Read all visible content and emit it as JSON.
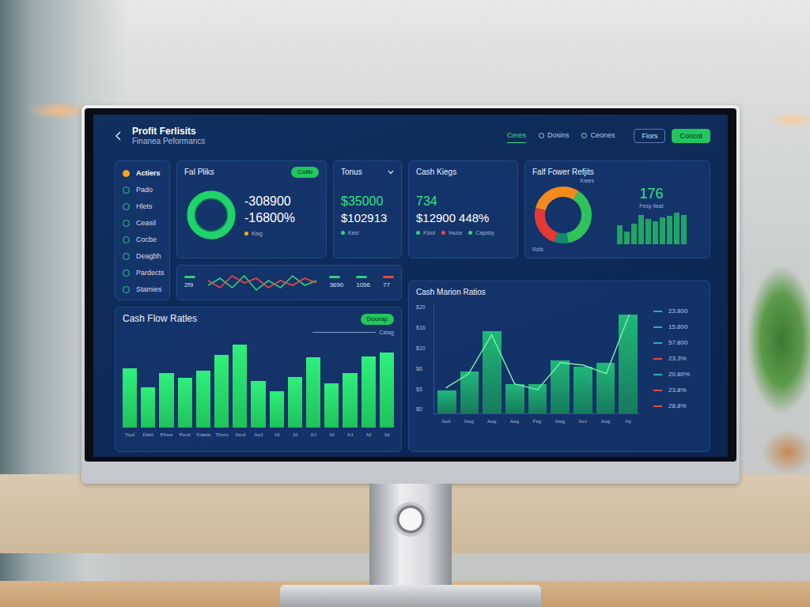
{
  "header": {
    "title": "Profit Ferlisits",
    "subtitle": "Finanea Peformancs",
    "nav": [
      {
        "label": "Ceres",
        "selected": true
      },
      {
        "label": "Dosins",
        "selected": false
      },
      {
        "label": "Ceones",
        "selected": false
      }
    ],
    "buttons": [
      {
        "label": "Fiors",
        "kind": "outline"
      },
      {
        "label": "Concot",
        "kind": "filled"
      }
    ]
  },
  "sidebar": {
    "items": [
      {
        "label": "Actiers",
        "color": "#f5a623",
        "selected": true
      },
      {
        "label": "Pado",
        "color": "#2fd27a",
        "selected": false
      },
      {
        "label": "Hlets",
        "color": "#2fd27a",
        "selected": false
      },
      {
        "label": "Ceasil",
        "color": "#2fd27a",
        "selected": false
      },
      {
        "label": "Cocbe",
        "color": "#2fd27a",
        "selected": false
      },
      {
        "label": "Deagbh",
        "color": "#2fd27a",
        "selected": false
      },
      {
        "label": "Pardects",
        "color": "#2fd27a",
        "selected": false
      },
      {
        "label": "Stamies",
        "color": "#2fd27a",
        "selected": false
      }
    ]
  },
  "pnl_card": {
    "title": "Fal Pliks",
    "pill": "Cotib",
    "values": [
      "-308900",
      "-16800%"
    ],
    "legend": {
      "label": "Kbig",
      "color": "#f0b400"
    }
  },
  "totals_card": {
    "title": "Tonus",
    "primary": "$35000",
    "secondary": "$102913",
    "legend": {
      "label": "Kesl",
      "color": "#2fd27a"
    }
  },
  "cash_kings": {
    "title": "Cash Kiegs",
    "value": "734",
    "amount": "$12900",
    "percent": "448%",
    "legend": [
      {
        "label": "Ksiol",
        "color": "#2fd27a"
      },
      {
        "label": "Inuce",
        "color": "#ef4444"
      },
      {
        "label": "Capisty",
        "color": "#2fd27a"
      }
    ]
  },
  "flow_returns": {
    "title": "Falf Fower Refjits",
    "segments": [
      {
        "value": 30,
        "color": "#f28b1e"
      },
      {
        "value": 38,
        "color": "#2fc35a"
      },
      {
        "value": 8,
        "color": "#138a6e"
      },
      {
        "value": 24,
        "color": "#e53935"
      }
    ],
    "labels": [
      "Kiees",
      "Rdls"
    ],
    "value": "176",
    "caption": "Fesy Ileat",
    "bars": [
      18,
      12,
      20,
      28,
      24,
      22,
      26,
      27,
      30,
      28
    ]
  },
  "trend_strip": {
    "items": [
      {
        "label": "2f9",
        "color": "#2fd27a"
      },
      {
        "label": "3690",
        "color": "#2fd27a"
      },
      {
        "label": "1056",
        "color": "#2fd27a"
      },
      {
        "label": "77",
        "color": "#ef4444"
      }
    ],
    "series": [
      {
        "color": "#2fd27a",
        "values": [
          4,
          7,
          3,
          8,
          2,
          6,
          3,
          8,
          4,
          6
        ]
      },
      {
        "color": "#ef4444",
        "values": [
          6,
          3,
          8,
          5,
          7,
          3,
          6,
          4,
          7,
          5
        ]
      }
    ]
  },
  "cash_flow": {
    "title": "Cash Flow Ratles",
    "pill": "Doorap",
    "note": "Catag",
    "max": 90,
    "values": [
      60,
      41,
      55,
      50,
      58,
      74,
      84,
      47,
      37,
      51,
      71,
      45,
      55,
      72,
      76
    ],
    "labels": [
      "Tual",
      "Dabl",
      "Fliwe",
      "Fecd",
      "Tomds",
      "Tiwrs",
      "Jucd",
      "Jucl",
      "Jd",
      "Jd",
      "Jcl",
      "Jd",
      "Jcl",
      "3d",
      "3d"
    ]
  },
  "margin_chart": {
    "title": "Cash Marion Ratios",
    "ticks": [
      "$20",
      "$16",
      "$10",
      "$6",
      "$5",
      "$0"
    ],
    "max": 130,
    "bars": [
      27,
      50,
      97,
      35,
      35,
      63,
      55,
      60,
      117
    ],
    "line": [
      30,
      47,
      93,
      35,
      28,
      60,
      57,
      47,
      117
    ],
    "labels": [
      "Jual",
      "Jaug",
      "Aug",
      "Aug",
      "Fug",
      "Jaug",
      "Jaci",
      "Aug",
      "Jaj"
    ],
    "legend": [
      {
        "label": "23.800",
        "color": "#1fb89a"
      },
      {
        "label": "15.800",
        "color": "#1fb89a"
      },
      {
        "label": "57.800",
        "color": "#1fb89a"
      },
      {
        "label": "23.3%",
        "color": "#ef4444"
      },
      {
        "label": "20.80%",
        "color": "#1fb89a"
      },
      {
        "label": "23.8%",
        "color": "#ef4444"
      },
      {
        "label": "28.8%",
        "color": "#ef4444"
      }
    ]
  }
}
